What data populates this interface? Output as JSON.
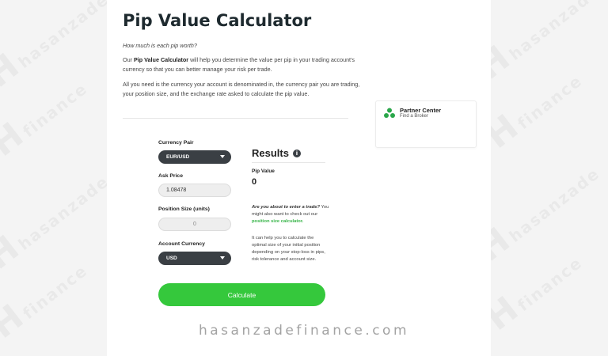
{
  "watermark": {
    "brand_mark": "H",
    "line1": "hasanzade",
    "line2": "finance",
    "footer": "hasanzadefinance.com"
  },
  "header": {
    "title": "Pip Value Calculator"
  },
  "intro": {
    "question": "How much is each pip worth?",
    "p1_prefix": "Our ",
    "p1_bold": "Pip Value Calculator",
    "p1_rest": " will help you determine the value per pip in your trading account's currency so that you can better manage your risk per trade.",
    "p2": "All you need is the currency your account is denominated in, the currency pair you are trading, your position size, and the exchange rate asked to calculate the pip value."
  },
  "form": {
    "currency_pair_label": "Currency Pair",
    "currency_pair_value": "EUR/USD",
    "ask_price_label": "Ask Price",
    "ask_price_value": "1.08478",
    "position_size_label": "Position Size (units)",
    "position_size_value": "0",
    "account_currency_label": "Account Currency",
    "account_currency_value": "USD",
    "calculate_label": "Calculate"
  },
  "results": {
    "title": "Results",
    "info_icon": "info-icon",
    "pip_value_label": "Pip Value",
    "pip_value": "0",
    "note1_italic": "Are you about to enter a trade?",
    "note1_rest": " You might also want to check out our",
    "note1_link": "position size calculator.",
    "note2": "It can help you to calculate the optimal size of your initial position depending on your stop-loss in pips, risk tolerance and account size."
  },
  "partner": {
    "title": "Partner Center",
    "subtitle": "Find a Broker",
    "icon": "partner-dots-icon"
  },
  "colors": {
    "accent_green": "#35c83c",
    "dark_control": "#3a3f44",
    "link_green": "#39b54a"
  }
}
